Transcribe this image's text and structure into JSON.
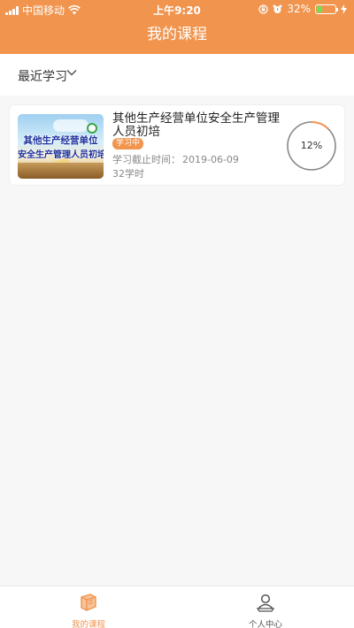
{
  "status_bar": {
    "carrier": "中国移动",
    "time": "上午9:20",
    "battery_percent": "32%",
    "battery_level": 0.32
  },
  "nav": {
    "title": "我的课程"
  },
  "filter": {
    "label": "最近学习"
  },
  "courses": [
    {
      "thumbnail_text_line1": "其他生产经营单位",
      "thumbnail_text_line2": "安全生产管理人员初培",
      "title": "其他生产经营单位安全生产管理人员初培",
      "status": "学习中",
      "deadline_label": "学习截止时间：",
      "deadline_date": "2019-06-09",
      "hours": "32学时",
      "progress_text": "12%",
      "progress_value": 0.12
    }
  ],
  "tab_bar": {
    "tabs": [
      {
        "label": "我的课程",
        "icon": "book-icon",
        "active": true
      },
      {
        "label": "个人中心",
        "icon": "user-icon",
        "active": false
      }
    ]
  },
  "colors": {
    "accent": "#f0944e",
    "battery": "#6fe05d"
  }
}
